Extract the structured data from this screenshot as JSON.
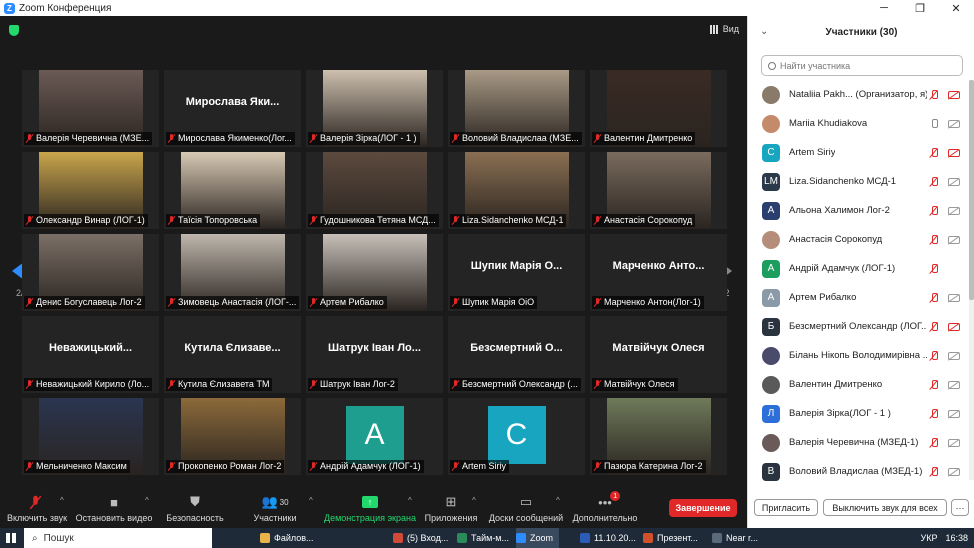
{
  "window": {
    "title": "Zoom Конференция"
  },
  "meeting": {
    "view_label": "Вид",
    "page_left": "2/2",
    "page_right": "2/2",
    "tiles": [
      {
        "label": "Валерія Черевична (МЗЕ...",
        "photo": "#6b5a55"
      },
      {
        "label": "Мирослава Якименко(Лог...",
        "display": "Мирослава  Яки...",
        "photo": ""
      },
      {
        "label": "Валерія Зірка(ЛОГ - 1 )",
        "photo": "#cdbfae"
      },
      {
        "label": "Воловий Владислаа (МЗЕ...",
        "photo": "#a99a86"
      },
      {
        "label": "Валентин Дмитренко",
        "photo": "#3a2a24"
      },
      {
        "label": "Олександр Винар (ЛОГ-1)",
        "photo": "#c9a64c"
      },
      {
        "label": "Таїсія Топоровська",
        "photo": "#d8c9b4"
      },
      {
        "label": "Гудошникова Тетяна МСД...",
        "photo": "#5c4a3e"
      },
      {
        "label": "Liza.Sidanchenko МСД-1",
        "photo": "#8a6f52"
      },
      {
        "label": "Анастасія Сорокопуд",
        "photo": "#7a6b5e"
      },
      {
        "label": "Денис Богуславець Лог-2",
        "photo": "#7b6f66"
      },
      {
        "label": "Зимовець Анастасія (ЛОГ-...",
        "photo": "#bfb7ad"
      },
      {
        "label": "Артем Рибалко",
        "photo": "#c8c0b8"
      },
      {
        "label": "Шупик Марія ОіО",
        "display": "Шупик  Марія  О...",
        "photo": ""
      },
      {
        "label": "Марченко Антон(Лог-1)",
        "display": "Марченко  Анто...",
        "photo": ""
      },
      {
        "label": "Неважицький Кирило (Ло...",
        "display": "Неважицький...",
        "photo": ""
      },
      {
        "label": "Кутила Єлизавета ТМ",
        "display": "Кутила  Єлизаве...",
        "photo": ""
      },
      {
        "label": "Шатрук Іван Лог-2",
        "display": "Шатрук  Іван  Ло...",
        "photo": ""
      },
      {
        "label": "Безсмертний Олександр (...",
        "display": "Безсмертний  О...",
        "photo": ""
      },
      {
        "label": "Матвійчук Олеся",
        "display": "Матвійчук  Олеся",
        "photo": ""
      },
      {
        "label": "Мельниченко Максим",
        "photo": "#2a3550"
      },
      {
        "label": "Прокопенко Роман Лог-2",
        "photo": "#8c6a3a"
      },
      {
        "label": "Андрій Адамчук (ЛОГ-1)",
        "letter": "A",
        "bg": "#1e9e8e"
      },
      {
        "label": "Artem Siriy",
        "letter": "C",
        "bg": "#17a5c0"
      },
      {
        "label": "Пазюра Катерина Лог-2",
        "photo": "#6f7a5a"
      }
    ]
  },
  "toolbar": {
    "mute": "Включить звук",
    "video": "Остановить видео",
    "security": "Безопасность",
    "participants": "Участники",
    "participants_count": "30",
    "share": "Демонстрация экрана",
    "apps": "Приложения",
    "whiteboards": "Доски сообщений",
    "more": "Дополнительно",
    "more_badge": "1",
    "end": "Завершение"
  },
  "panel": {
    "title": "Участники (30)",
    "search_placeholder": "Найти участника",
    "invite": "Пригласить",
    "mute_all": "Выключить звук для всех",
    "more": "···",
    "participants": [
      {
        "name": "Nataliia Pakh... (Организатор, я)",
        "avatar": "",
        "color": "#8a7a6a",
        "mic": "off",
        "cam": "off"
      },
      {
        "name": "Mariia Khudiakova",
        "avatar": "",
        "color": "#c58a6a",
        "mic": "on",
        "cam": "gray"
      },
      {
        "name": "Artem Siriy",
        "avatar": "C",
        "color": "#17a5c0",
        "mic": "off",
        "cam": "off"
      },
      {
        "name": "Liza.Sidanchenko МСД-1",
        "avatar": "LM",
        "color": "#2b3a4a",
        "mic": "off",
        "cam": "gray"
      },
      {
        "name": "Альона Халимон Лог-2",
        "avatar": "A",
        "color": "#2a3f6e",
        "mic": "off",
        "cam": "gray"
      },
      {
        "name": "Анастасія Сорокопуд",
        "avatar": "",
        "color": "#b58e7a",
        "mic": "off",
        "cam": "gray"
      },
      {
        "name": "Андрій Адамчук (ЛОГ-1)",
        "avatar": "A",
        "color": "#1e9e5e",
        "mic": "off",
        "cam": "none"
      },
      {
        "name": "Артем Рибалко",
        "avatar": "A",
        "color": "#8a9aa8",
        "mic": "off",
        "cam": "gray"
      },
      {
        "name": "Безсмертний Олександр (ЛОГ...",
        "avatar": "Б",
        "color": "#2a3440",
        "mic": "off",
        "cam": "off"
      },
      {
        "name": "Білань Нікопь Володимирівна ...",
        "avatar": "",
        "color": "#4a4a6a",
        "mic": "off",
        "cam": "gray"
      },
      {
        "name": "Валентин Дмитренко",
        "avatar": "",
        "color": "#5a5a5a",
        "mic": "off",
        "cam": "gray"
      },
      {
        "name": "Валерія Зірка(ЛОГ - 1 )",
        "avatar": "Л",
        "color": "#2d6fd8",
        "mic": "off",
        "cam": "gray"
      },
      {
        "name": "Валерія Черевична (МЗЕД-1)",
        "avatar": "",
        "color": "#6a5a5a",
        "mic": "off",
        "cam": "gray"
      },
      {
        "name": "Воловий Владислаа (МЗЕД-1)",
        "avatar": "B",
        "color": "#2a3440",
        "mic": "off",
        "cam": "gray"
      }
    ]
  },
  "taskbar": {
    "search": "Пошук",
    "items": [
      {
        "label": "Файлов...",
        "color": "#e8b44a"
      },
      {
        "label": "(5) Вход...",
        "color": "#d04a3a"
      },
      {
        "label": "Тайм-м...",
        "color": "#2a8a5a"
      },
      {
        "label": "Zoom",
        "color": "#2d8cff"
      },
      {
        "label": "11.10.20...",
        "color": "#2b5cb8"
      },
      {
        "label": "Презент...",
        "color": "#d0502a"
      },
      {
        "label": "Near r...",
        "color": "#5a6a7a"
      }
    ],
    "lang": "УКР",
    "time": "16:38"
  }
}
